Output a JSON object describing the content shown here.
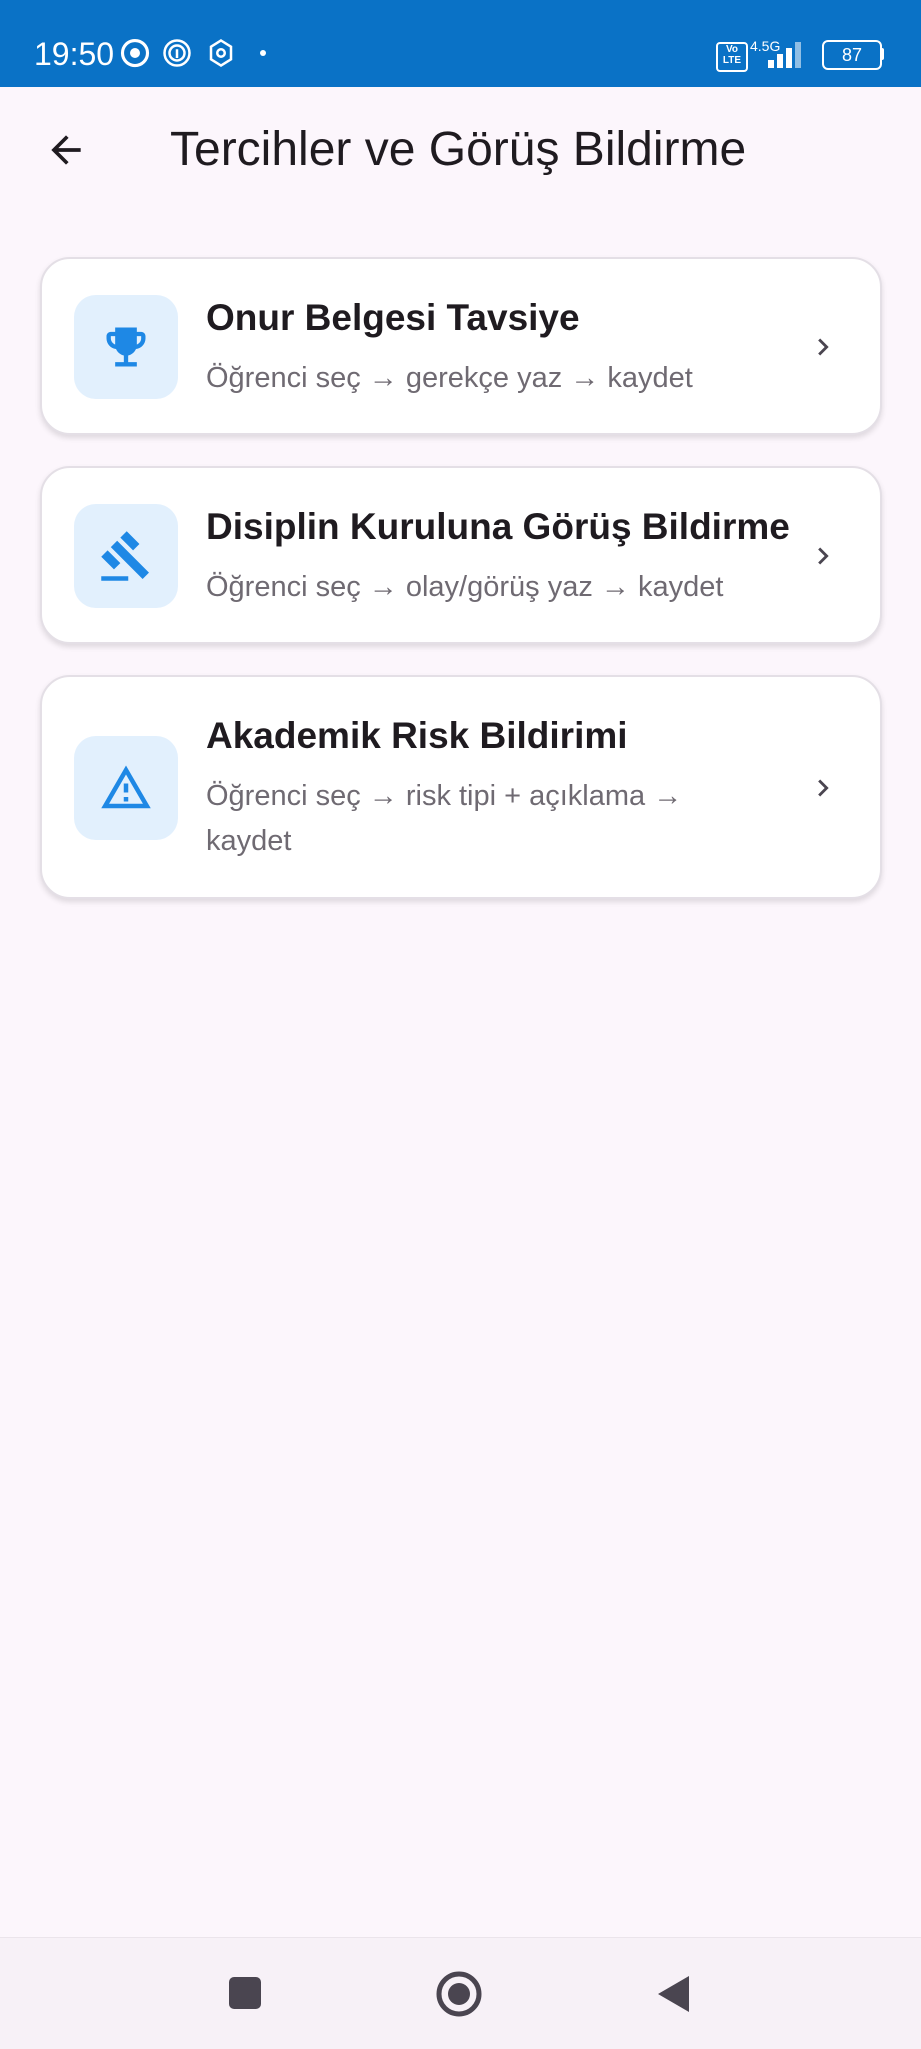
{
  "status_bar": {
    "time": "19:50",
    "lte": "Vo\nLTE",
    "network": "4.5G",
    "battery": "87",
    "icons": [
      "chrome-icon",
      "fingerprint-icon",
      "openai-icon",
      "notification-dot",
      "volte-icon",
      "signal-icon",
      "battery-icon"
    ]
  },
  "app_bar": {
    "title": "Tercihler ve Görüş Bildirme",
    "back_icon": "arrow-back-icon"
  },
  "cards": [
    {
      "title": "Onur Belgesi Tavsiye",
      "subtitle": "Öğrenci seç → gerekçe yaz → kaydet",
      "icon": "trophy-icon"
    },
    {
      "title": "Disiplin Kuruluna Görüş Bildirme",
      "subtitle": "Öğrenci seç → olay/görüş yaz → kaydet",
      "icon": "gavel-icon"
    },
    {
      "title": "Akademik Risk Bildirimi",
      "subtitle": "Öğrenci seç → risk tipi + açıklama → kaydet",
      "icon": "warning-icon"
    }
  ],
  "nav_bar": {
    "buttons": [
      "recents-button",
      "home-button",
      "back-button"
    ]
  },
  "colors": {
    "status_bar": "#0a72c6",
    "background": "#fcf6fc",
    "accent": "#1e88e5",
    "icon_tile": "#e2f0fd"
  }
}
